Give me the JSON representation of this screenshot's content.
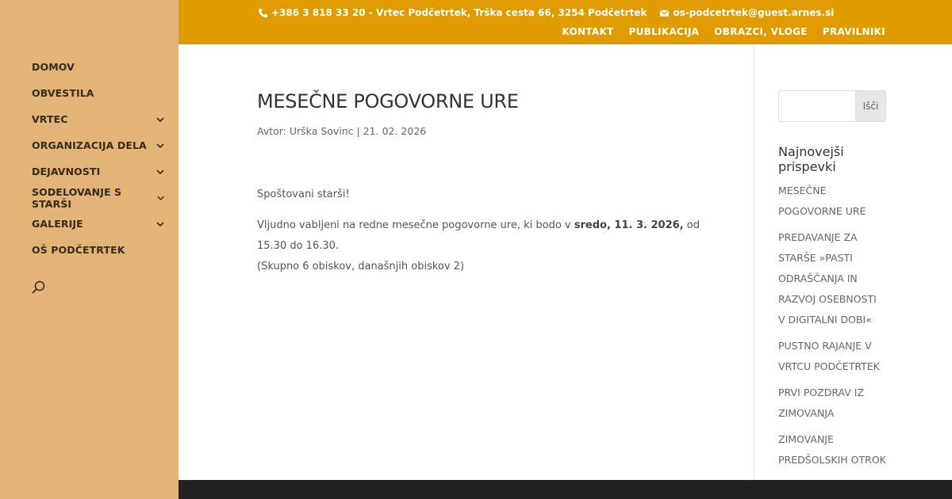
{
  "sidebar": {
    "items": [
      {
        "label": "DOMOV",
        "has_sub": false
      },
      {
        "label": "OBVESTILA",
        "has_sub": false
      },
      {
        "label": "VRTEC",
        "has_sub": true
      },
      {
        "label": "ORGANIZACIJA DELA",
        "has_sub": true
      },
      {
        "label": "DEJAVNOSTI",
        "has_sub": true
      },
      {
        "label": "SODELOVANJE S STARŠI",
        "has_sub": true
      },
      {
        "label": "GALERIJE",
        "has_sub": true
      },
      {
        "label": "OŠ PODČETRTEK",
        "has_sub": false
      }
    ]
  },
  "topbar": {
    "phone_text": "+386 3 818 33 20 - Vrtec Podčetrtek, Trška cesta 66, 3254 Podčetrtek",
    "email_text": "os-podcetrtek@guest.arnes.si",
    "nav": [
      "KONTAKT",
      "PUBLIKACIJA",
      "OBRAZCI, VLOGE",
      "PRAVILNIKI"
    ]
  },
  "post": {
    "title": "MESEČNE POGOVORNE URE",
    "meta": "Avtor: Urška Sovinc | 21. 02. 2026",
    "greeting": "Spoštovani starši!",
    "text_before": "Vljudno vabljeni na redne mesečne pogovorne ure, ki bodo v ",
    "text_bold": "sredo, 11. 3. 2026,",
    "text_after": " od 15.30 do 16.30.",
    "visits": "(Skupno 6 obiskov, današnjih obiskov 2)"
  },
  "right": {
    "search_button": "Išči",
    "search_value": "",
    "recent_title": "Najnovejši prispevki",
    "recent": [
      "MESEČNE POGOVORNE URE",
      "PREDAVANJE ZA STARŠE »PASTI ODRAŠČANJA IN RAZVOJ OSEBNOSTI V DIGITALNI DOBI«",
      "PUSTNO RAJANJE V VRTCU PODČETRTEK",
      "PRVI POZDRAV IZ ZIMOVANJA",
      "ZIMOVANJE PREDŠOLSKIH OTROK"
    ]
  },
  "colors": {
    "sidebar_bg": "#e2b478",
    "topbar_bg": "#e09b00",
    "footer_bg": "#222222"
  }
}
